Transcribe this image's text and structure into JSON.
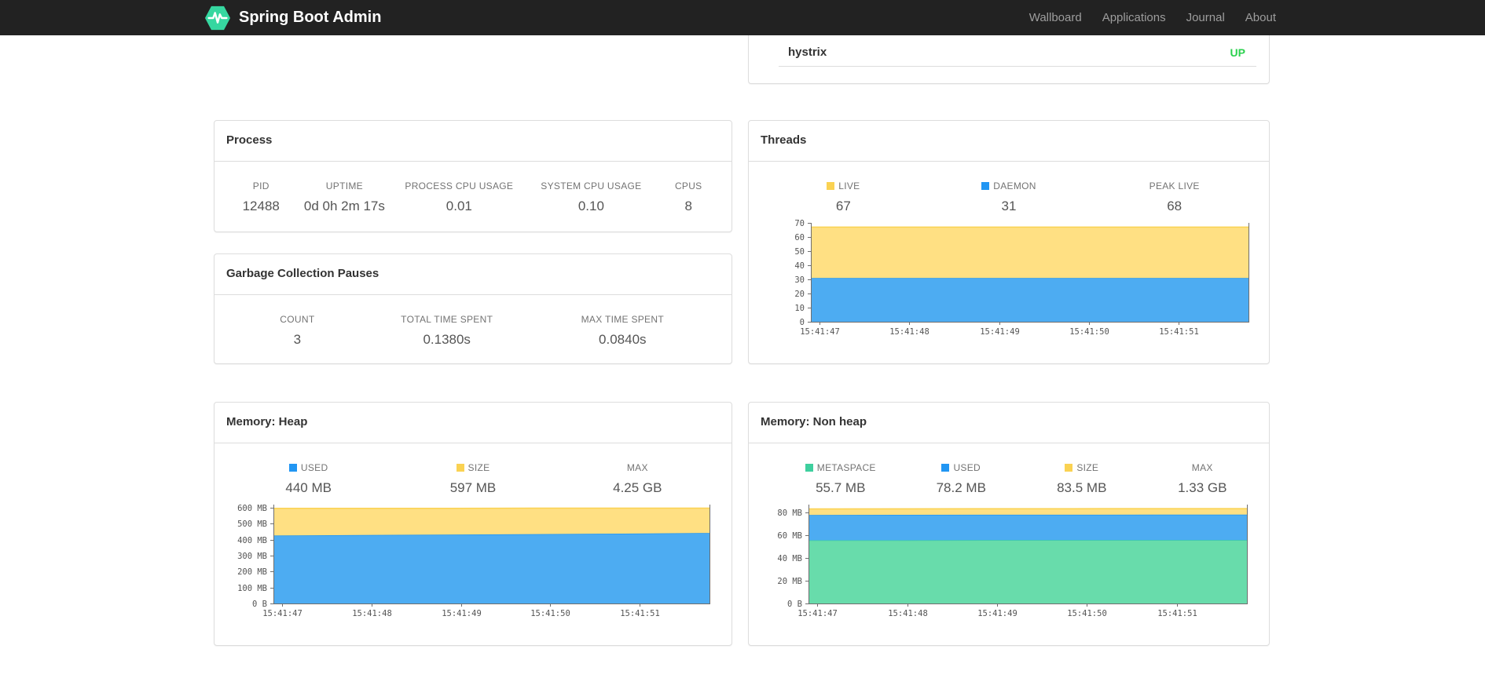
{
  "navbar": {
    "brand": "Spring Boot Admin",
    "items": [
      {
        "label": "Wallboard"
      },
      {
        "label": "Applications"
      },
      {
        "label": "Journal"
      },
      {
        "label": "About"
      }
    ]
  },
  "colors": {
    "brand_green": "#36D7A0",
    "status_up": "#2BD14E",
    "legend_yellow": "#FAD252",
    "area_yellow": "#FFE083",
    "legend_blue": "#2196F3",
    "area_blue": "#4DACF2",
    "legend_green": "#3ECF9E",
    "area_green": "#68DCAB",
    "navbar_bg": "#222222"
  },
  "hystrix_panel": {
    "app_name": "hystrix",
    "status": "UP"
  },
  "panels": {
    "process": {
      "title": "Process",
      "stats": [
        {
          "label": "PID",
          "value": "12488"
        },
        {
          "label": "UPTIME",
          "value": "0d 0h 2m 17s"
        },
        {
          "label": "PROCESS CPU USAGE",
          "value": "0.01"
        },
        {
          "label": "SYSTEM CPU USAGE",
          "value": "0.10"
        },
        {
          "label": "CPUS",
          "value": "8"
        }
      ]
    },
    "gc": {
      "title": "Garbage Collection Pauses",
      "stats": [
        {
          "label": "COUNT",
          "value": "3"
        },
        {
          "label": "TOTAL TIME SPENT",
          "value": "0.1380s"
        },
        {
          "label": "MAX TIME SPENT",
          "value": "0.0840s"
        }
      ]
    },
    "threads": {
      "title": "Threads",
      "stats": [
        {
          "label": "LIVE",
          "value": "67",
          "swatch": "#FAD252"
        },
        {
          "label": "DAEMON",
          "value": "31",
          "swatch": "#2196F3"
        },
        {
          "label": "PEAK LIVE",
          "value": "68"
        }
      ]
    },
    "heap": {
      "title": "Memory: Heap",
      "stats": [
        {
          "label": "USED",
          "value": "440 MB",
          "swatch": "#2196F3"
        },
        {
          "label": "SIZE",
          "value": "597 MB",
          "swatch": "#FAD252"
        },
        {
          "label": "MAX",
          "value": "4.25 GB"
        }
      ]
    },
    "nonheap": {
      "title": "Memory: Non heap",
      "stats": [
        {
          "label": "METASPACE",
          "value": "55.7 MB",
          "swatch": "#3ECF9E"
        },
        {
          "label": "USED",
          "value": "78.2 MB",
          "swatch": "#2196F3"
        },
        {
          "label": "SIZE",
          "value": "83.5 MB",
          "swatch": "#FAD252"
        },
        {
          "label": "MAX",
          "value": "1.33 GB"
        }
      ]
    }
  },
  "chart_data": [
    {
      "id": "threads",
      "title": "Threads",
      "type": "area",
      "stacked": true,
      "values_are": "stack_top",
      "x_labels": [
        "15:41:47",
        "15:41:48",
        "15:41:49",
        "15:41:50",
        "15:41:51"
      ],
      "x_tick_fracs": [
        0.02,
        0.225,
        0.43,
        0.635,
        0.84
      ],
      "ylim": [
        0,
        70
      ],
      "grid": false,
      "legend_position": "above",
      "yticks": [
        {
          "v": 0,
          "label": "0"
        },
        {
          "v": 10,
          "label": "10"
        },
        {
          "v": 20,
          "label": "20"
        },
        {
          "v": 30,
          "label": "30"
        },
        {
          "v": 40,
          "label": "40"
        },
        {
          "v": 50,
          "label": "50"
        },
        {
          "v": 60,
          "label": "60"
        },
        {
          "v": 70,
          "label": "70"
        }
      ],
      "series": [
        {
          "name": "DAEMON",
          "line": "#2196F3",
          "fill": "#4DACF2",
          "values": [
            31,
            31,
            31,
            31,
            31,
            31
          ]
        },
        {
          "name": "LIVE",
          "line": "#FAD252",
          "fill": "#FFE083",
          "values": [
            67,
            67,
            67,
            67,
            67,
            67
          ]
        }
      ]
    },
    {
      "id": "memory-heap",
      "title": "Memory: Heap",
      "type": "area",
      "stacked": true,
      "values_are": "stack_top",
      "x_labels": [
        "15:41:47",
        "15:41:48",
        "15:41:49",
        "15:41:50",
        "15:41:51"
      ],
      "x_tick_fracs": [
        0.02,
        0.225,
        0.43,
        0.635,
        0.84
      ],
      "ylim": [
        0,
        620
      ],
      "unit": "MB",
      "grid": false,
      "legend_position": "above",
      "yticks": [
        {
          "v": 0,
          "label": "0 B"
        },
        {
          "v": 100,
          "label": "100 MB"
        },
        {
          "v": 200,
          "label": "200 MB"
        },
        {
          "v": 300,
          "label": "300 MB"
        },
        {
          "v": 400,
          "label": "400 MB"
        },
        {
          "v": 500,
          "label": "500 MB"
        },
        {
          "v": 600,
          "label": "600 MB"
        }
      ],
      "series": [
        {
          "name": "USED",
          "line": "#2196F3",
          "fill": "#4DACF2",
          "values": [
            426,
            429,
            432,
            435,
            438,
            442
          ]
        },
        {
          "name": "SIZE",
          "line": "#FAD252",
          "fill": "#FFE083",
          "values": [
            597,
            597,
            597,
            598,
            598,
            598
          ]
        }
      ]
    },
    {
      "id": "memory-nonheap",
      "title": "Memory: Non heap",
      "type": "area",
      "stacked": true,
      "values_are": "stack_top",
      "x_labels": [
        "15:41:47",
        "15:41:48",
        "15:41:49",
        "15:41:50",
        "15:41:51"
      ],
      "x_tick_fracs": [
        0.02,
        0.225,
        0.43,
        0.635,
        0.84
      ],
      "ylim": [
        0,
        87
      ],
      "unit": "MB",
      "grid": false,
      "legend_position": "above",
      "yticks": [
        {
          "v": 0,
          "label": "0 B"
        },
        {
          "v": 20,
          "label": "20 MB"
        },
        {
          "v": 40,
          "label": "40 MB"
        },
        {
          "v": 60,
          "label": "60 MB"
        },
        {
          "v": 80,
          "label": "80 MB"
        }
      ],
      "series": [
        {
          "name": "METASPACE",
          "line": "#3ECF9E",
          "fill": "#68DCAB",
          "values": [
            55.6,
            55.6,
            55.7,
            55.7,
            55.7,
            55.7
          ]
        },
        {
          "name": "USED",
          "line": "#2196F3",
          "fill": "#4DACF2",
          "values": [
            77.9,
            78.0,
            78.1,
            78.1,
            78.2,
            78.2
          ]
        },
        {
          "name": "SIZE",
          "line": "#FAD252",
          "fill": "#FFE083",
          "values": [
            83.2,
            83.3,
            83.4,
            83.4,
            83.5,
            83.5
          ]
        }
      ]
    }
  ]
}
